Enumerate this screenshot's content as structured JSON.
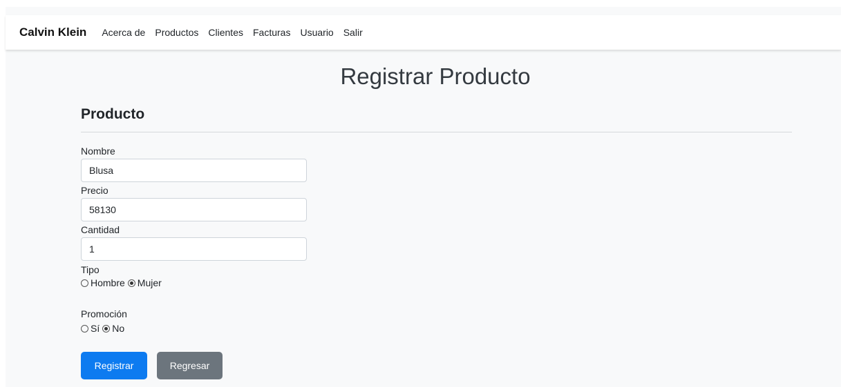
{
  "navbar": {
    "brand": "Calvin Klein",
    "links": [
      "Acerca de",
      "Productos",
      "Clientes",
      "Facturas",
      "Usuario",
      "Salir"
    ]
  },
  "page": {
    "title": "Registrar Producto",
    "section_title": "Producto"
  },
  "form": {
    "nombre_label": "Nombre",
    "nombre_value": "Blusa",
    "precio_label": "Precio",
    "precio_value": "58130",
    "cantidad_label": "Cantidad",
    "cantidad_value": "1",
    "tipo_label": "Tipo",
    "tipo_options": [
      "Hombre",
      "Mujer"
    ],
    "tipo_selected": "Mujer",
    "promocion_label": "Promoción",
    "promocion_options": [
      "Sí",
      "No"
    ],
    "promocion_selected": "No"
  },
  "buttons": {
    "registrar": "Registrar",
    "regresar": "Regresar"
  },
  "colors": {
    "primary": "#0d7bf0",
    "secondary": "#6c757d",
    "background": "#f8f9fa"
  }
}
